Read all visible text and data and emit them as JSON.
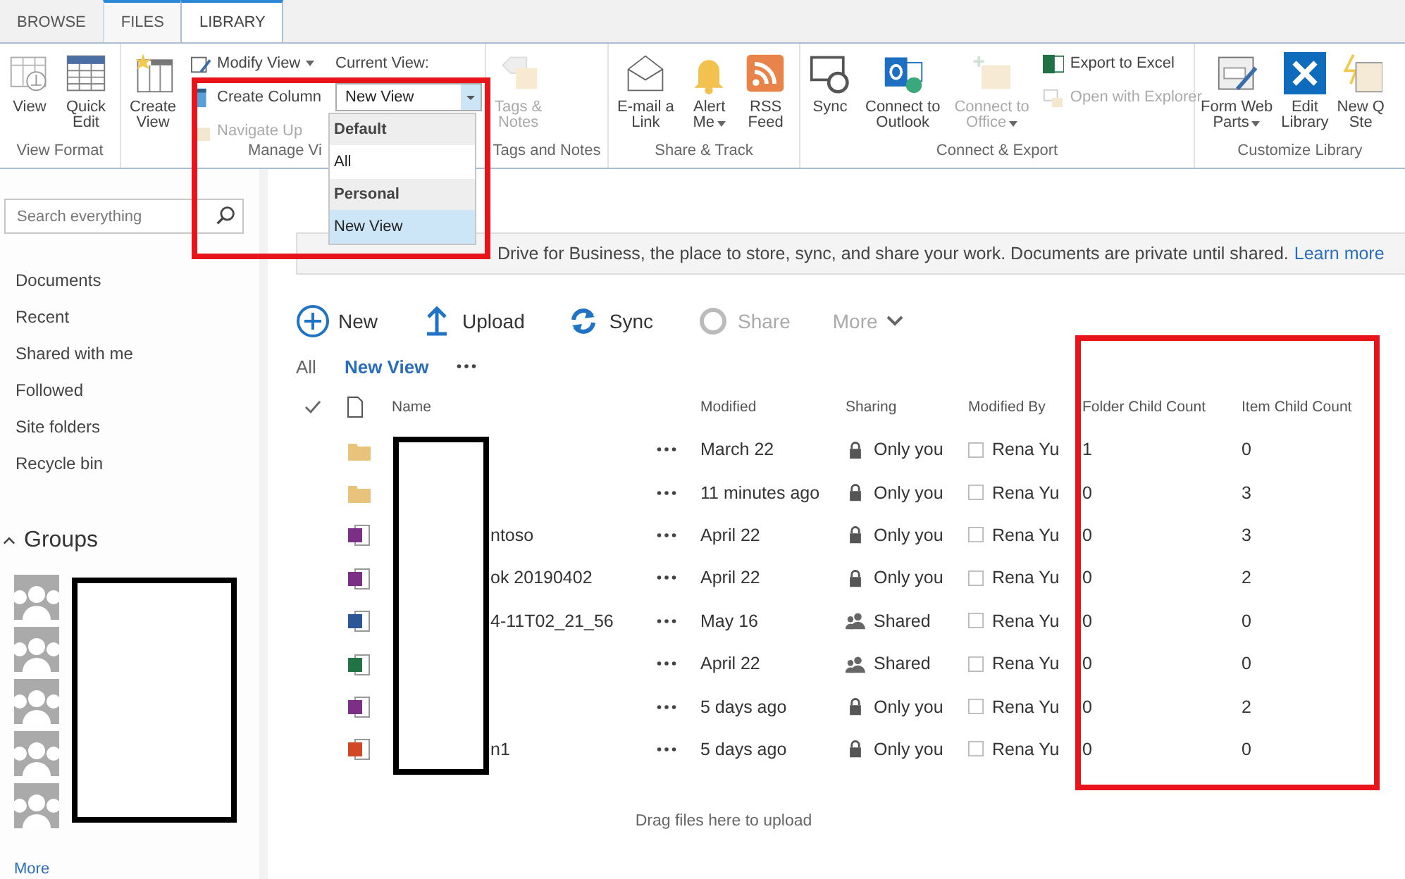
{
  "tabs": [
    {
      "label": "BROWSE",
      "selected": false,
      "contextual": false
    },
    {
      "label": "FILES",
      "selected": false,
      "contextual": true
    },
    {
      "label": "LIBRARY",
      "selected": true,
      "contextual": true
    }
  ],
  "ribbon": {
    "groups": [
      {
        "label": "View Format",
        "items": [
          {
            "kind": "large",
            "lines": [
              "View"
            ],
            "menu": false,
            "disabled": false
          },
          {
            "kind": "large",
            "lines": [
              "Quick",
              "Edit"
            ],
            "menu": false,
            "disabled": false
          }
        ]
      },
      {
        "label": "Manage Vi",
        "items": [
          {
            "kind": "large",
            "lines": [
              "Create",
              "View"
            ],
            "menu": false,
            "disabled": false
          },
          {
            "kind": "stack",
            "items": [
              {
                "label": "Modify View",
                "menu": true,
                "disabled": false
              },
              {
                "label": "Create Column",
                "menu": false,
                "disabled": false
              },
              {
                "label": "Navigate Up",
                "menu": false,
                "disabled": true
              }
            ]
          },
          {
            "kind": "view-picker",
            "label": "Current View:",
            "value": "New View"
          }
        ]
      },
      {
        "label": "Tags and Notes",
        "items": [
          {
            "kind": "large",
            "lines": [
              "Tags &",
              "Notes"
            ],
            "menu": false,
            "disabled": true
          }
        ]
      },
      {
        "label": "Share & Track",
        "items": [
          {
            "kind": "large",
            "lines": [
              "E-mail a",
              "Link"
            ],
            "menu": false,
            "disabled": false
          },
          {
            "kind": "large",
            "lines": [
              "Alert",
              "Me"
            ],
            "menu": true,
            "disabled": false
          },
          {
            "kind": "large",
            "lines": [
              "RSS",
              "Feed"
            ],
            "menu": false,
            "disabled": false
          }
        ]
      },
      {
        "label": "Connect & Export",
        "items": [
          {
            "kind": "large",
            "lines": [
              "Sync"
            ],
            "menu": false,
            "disabled": false
          },
          {
            "kind": "large",
            "lines": [
              "Connect to",
              "Outlook"
            ],
            "menu": false,
            "disabled": false
          },
          {
            "kind": "large",
            "lines": [
              "Connect to",
              "Office"
            ],
            "menu": true,
            "disabled": true
          },
          {
            "kind": "stack",
            "items": [
              {
                "label": "Export to Excel",
                "menu": false,
                "disabled": false
              },
              {
                "label": "Open with Explorer",
                "menu": false,
                "disabled": true
              }
            ]
          }
        ]
      },
      {
        "label": "Customize Library",
        "items": [
          {
            "kind": "large",
            "lines": [
              "Form Web",
              "Parts"
            ],
            "menu": true,
            "disabled": false
          },
          {
            "kind": "large",
            "lines": [
              "Edit",
              "Library"
            ],
            "menu": false,
            "disabled": false
          },
          {
            "kind": "large",
            "lines": [
              "New Q",
              "Ste"
            ],
            "menu": false,
            "disabled": false
          }
        ]
      }
    ]
  },
  "view_menu": {
    "sections": [
      {
        "heading": "Default",
        "options": [
          {
            "label": "All",
            "selected": false
          }
        ]
      },
      {
        "heading": "Personal",
        "options": [
          {
            "label": "New View",
            "selected": true
          }
        ]
      }
    ]
  },
  "search": {
    "placeholder": "Search everything"
  },
  "nav": {
    "items": [
      "Documents",
      "Recent",
      "Shared with me",
      "Followed",
      "Site folders",
      "Recycle bin"
    ]
  },
  "groups": {
    "title": "Groups",
    "expanded": true,
    "items": [
      {
        "kind": "group"
      },
      {
        "kind": "group"
      },
      {
        "kind": "group"
      },
      {
        "kind": "group"
      },
      {
        "kind": "group"
      }
    ],
    "more": "More"
  },
  "banner": {
    "text": "Drive for Business, the place to store, sync, and share your work. Documents are private until shared.",
    "link": "Learn more"
  },
  "commands": [
    {
      "label": "New",
      "disabled": false,
      "menu": false
    },
    {
      "label": "Upload",
      "disabled": false,
      "menu": false
    },
    {
      "label": "Sync",
      "disabled": false,
      "menu": false
    },
    {
      "label": "Share",
      "disabled": true,
      "menu": false
    },
    {
      "label": "More",
      "disabled": true,
      "menu": true
    }
  ],
  "views": [
    {
      "label": "All",
      "selected": false
    },
    {
      "label": "New View",
      "selected": true
    }
  ],
  "table": {
    "columns": [
      "Name",
      "Modified",
      "Sharing",
      "Modified By",
      "Folder Child Count",
      "Item Child Count"
    ],
    "rows": [
      {
        "kind": "folder",
        "modified": "March 22",
        "sharing": "Only you",
        "shared": false,
        "modified_by": "Rena Yu",
        "folder_child_count": "1",
        "item_child_count": "0"
      },
      {
        "kind": "folder",
        "modified": "11 minutes ago",
        "sharing": "Only you",
        "shared": false,
        "modified_by": "Rena Yu",
        "folder_child_count": "0",
        "item_child_count": "3"
      },
      {
        "kind": "onenote",
        "name": "ntoso",
        "modified": "April 22",
        "sharing": "Only you",
        "shared": false,
        "modified_by": "Rena Yu",
        "folder_child_count": "0",
        "item_child_count": "3"
      },
      {
        "kind": "onenote",
        "name": "ok 20190402",
        "modified": "April 22",
        "sharing": "Only you",
        "shared": false,
        "modified_by": "Rena Yu",
        "folder_child_count": "0",
        "item_child_count": "2"
      },
      {
        "kind": "word",
        "name": "4-11T02_21_56",
        "modified": "May 16",
        "sharing": "Shared",
        "shared": true,
        "modified_by": "Rena Yu",
        "folder_child_count": "0",
        "item_child_count": "0"
      },
      {
        "kind": "excel",
        "modified": "April 22",
        "sharing": "Shared",
        "shared": true,
        "modified_by": "Rena Yu",
        "folder_child_count": "0",
        "item_child_count": "0"
      },
      {
        "kind": "onenote",
        "modified": "5 days ago",
        "sharing": "Only you",
        "shared": false,
        "modified_by": "Rena Yu",
        "folder_child_count": "0",
        "item_child_count": "2"
      },
      {
        "kind": "powerpoint",
        "name": "n1",
        "modified": "5 days ago",
        "sharing": "Only you",
        "shared": false,
        "modified_by": "Rena Yu",
        "folder_child_count": "0",
        "item_child_count": "0"
      }
    ],
    "drop_hint": "Drag files here to upload"
  },
  "annotations": [
    {
      "kind": "red-frame"
    },
    {
      "kind": "red-frame"
    },
    {
      "kind": "redaction"
    },
    {
      "kind": "redaction"
    }
  ]
}
